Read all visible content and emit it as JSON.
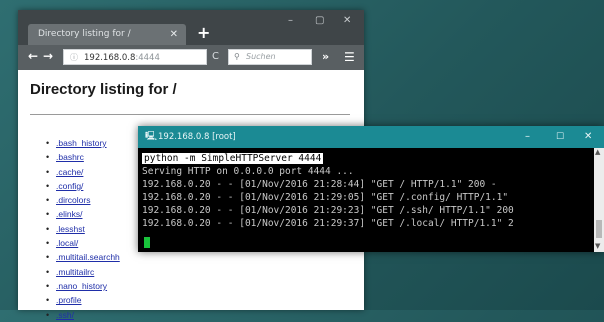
{
  "browser": {
    "tab_title": "Directory listing for /",
    "tab_close": "✕",
    "new_tab": "+",
    "window_controls": {
      "minimize": "–",
      "maximize": "▢",
      "close": "✕"
    },
    "url_host": "192.168.0.8",
    "url_port": ":4444",
    "search_placeholder": "Suchen",
    "icons": {
      "back": "arrow-left-icon",
      "forward": "arrow-right-icon",
      "info": "info-icon",
      "reload": "reload-icon",
      "search": "search-icon",
      "overflow": "overflow-icon",
      "menu": "hamburger-menu-icon"
    }
  },
  "page": {
    "heading": "Directory listing for /",
    "files": [
      ".bash_history",
      ".bashrc",
      ".cache/",
      ".config/",
      ".dircolors",
      ".elinks/",
      ".lesshst",
      ".local/",
      ".multitail.searchh",
      ".multitailrc",
      ".nano_history",
      ".profile",
      ".ssh/"
    ]
  },
  "terminal": {
    "title": "192.168.0.8 [root]",
    "title_bar_color": "#1b8a94",
    "command": "python -m SimpleHTTPServer 4444",
    "lines": [
      "Serving HTTP on 0.0.0.0 port 4444 ...",
      "192.168.0.20 - - [01/Nov/2016 21:28:44] \"GET / HTTP/1.1\" 200 -",
      "192.168.0.20 - - [01/Nov/2016 21:29:05] \"GET /.config/ HTTP/1.1\"",
      "192.168.0.20 - - [01/Nov/2016 21:29:23] \"GET /.ssh/ HTTP/1.1\" 200",
      "192.168.0.20 - - [01/Nov/2016 21:29:37] \"GET /.local/ HTTP/1.1\" 2"
    ],
    "cursor_color": "#19c33b",
    "window_controls": {
      "minimize": "–",
      "maximize": "☐",
      "close": "✕"
    }
  }
}
